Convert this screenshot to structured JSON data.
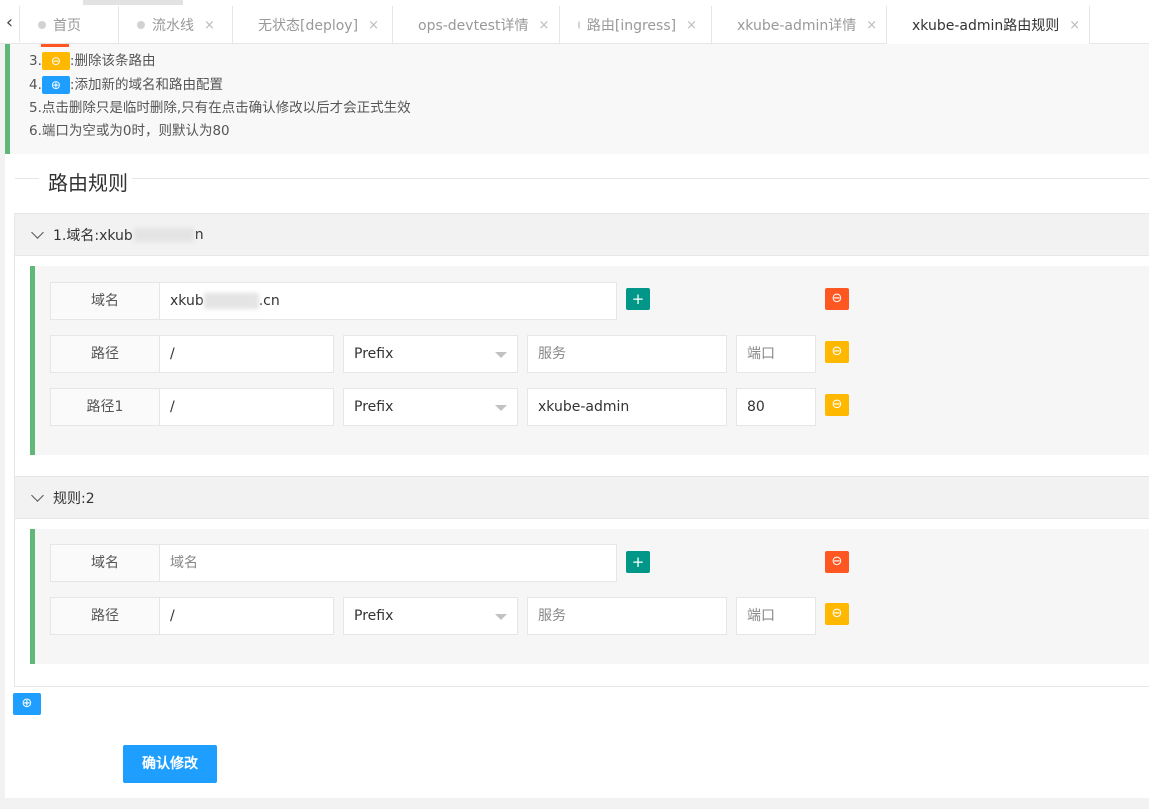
{
  "tabs": [
    {
      "label": "首页",
      "closable": false,
      "active": false
    },
    {
      "label": "流水线",
      "closable": true,
      "active": false
    },
    {
      "label": "无状态[deploy]",
      "closable": true,
      "active": false
    },
    {
      "label": "ops-devtest详情",
      "closable": true,
      "active": false
    },
    {
      "label": "路由[ingress]",
      "closable": true,
      "active": false
    },
    {
      "label": "xkube-admin详情",
      "closable": true,
      "active": false
    },
    {
      "label": "xkube-admin路由规则",
      "closable": true,
      "active": true
    }
  ],
  "tab_nav": {
    "prev": "‹",
    "close": "×"
  },
  "notes": {
    "n3_prefix": "3.",
    "n3_text": ":删除该条路由",
    "n4_prefix": "4.",
    "n4_text": ":添加新的域名和路由配置",
    "n5": "5.点击删除只是临时删除,只有在点击确认修改以后才会正式生效",
    "n6": "6.端口为空或为0时，则默认为80"
  },
  "section_title": "路由规则",
  "icons": {
    "minus": "⊖",
    "plus_circle": "⊕",
    "plus": "+"
  },
  "rules": [
    {
      "header": "1.域名:xkub",
      "header_tail": "n",
      "host_label": "域名",
      "host_value": "xkub",
      "host_tail": ".cn",
      "paths": [
        {
          "label": "路径",
          "path": "/",
          "type": "Prefix",
          "service": "",
          "service_placeholder": "服务",
          "port": "",
          "port_placeholder": "端口"
        },
        {
          "label": "路径1",
          "path": "/",
          "type": "Prefix",
          "service": "xkube-admin",
          "service_placeholder": "服务",
          "port": "80",
          "port_placeholder": "端口"
        }
      ]
    },
    {
      "header": "规则:2",
      "host_label": "域名",
      "host_value": "",
      "host_placeholder": "域名",
      "paths": [
        {
          "label": "路径",
          "path": "/",
          "type": "Prefix",
          "service": "",
          "service_placeholder": "服务",
          "port": "",
          "port_placeholder": "端口"
        }
      ]
    }
  ],
  "confirm_button": "确认修改",
  "colors": {
    "primary": "#1E9FFF",
    "green_border": "#5FB878",
    "teal": "#009688",
    "danger": "#FF5722",
    "warn": "#FFB800"
  }
}
